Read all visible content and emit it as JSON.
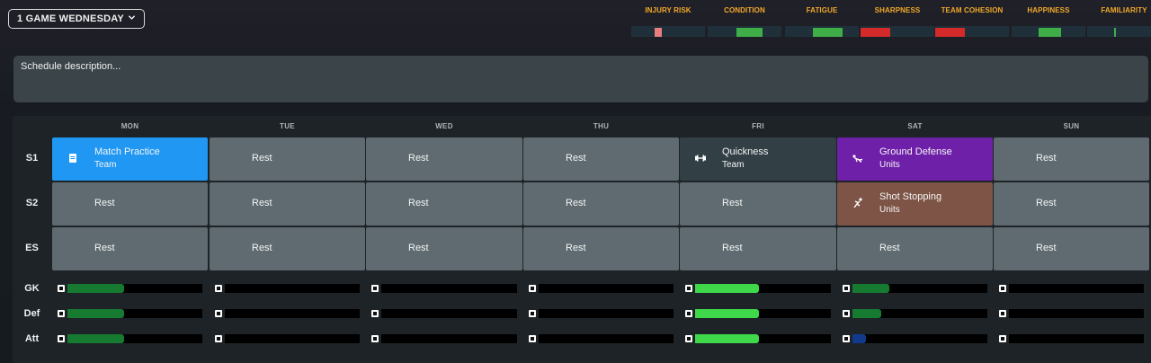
{
  "schedule_selector": {
    "label": "1 GAME WEDNESDAY"
  },
  "status": [
    {
      "label": "INJURY RISK",
      "level": 0.1,
      "color": "#e87e7e"
    },
    {
      "label": "CONDITION",
      "level": 0.35,
      "color": "#3fae49"
    },
    {
      "label": "FATIGUE",
      "level": 0.4,
      "color": "#3fae49"
    },
    {
      "label": "SHARPNESS",
      "level": 0.4,
      "color": "#d42a2a"
    },
    {
      "label": "TEAM COHESION",
      "level": 0.4,
      "color": "#d42a2a"
    },
    {
      "label": "HAPPINESS",
      "level": 0.3,
      "color": "#3fae49"
    },
    {
      "label": "FAMILIARITY",
      "level": 0.03,
      "color": "#3fae49"
    }
  ],
  "description": {
    "placeholder": "Schedule description..."
  },
  "days": [
    "MON",
    "TUE",
    "WED",
    "THU",
    "FRI",
    "SAT",
    "SUN"
  ],
  "sessions": [
    {
      "label": "S1",
      "cells": [
        {
          "title": "Match Practice",
          "subtitle": "Team",
          "color": "#1f97f3",
          "icon": "clipboard-icon"
        },
        {
          "title": "Rest"
        },
        {
          "title": "Rest"
        },
        {
          "title": "Rest"
        },
        {
          "title": "Quickness",
          "subtitle": "Team",
          "color": "#323f45",
          "icon": "dumbbell-icon"
        },
        {
          "title": "Ground Defense",
          "subtitle": "Units",
          "color": "#6f20a8",
          "icon": "slide-tackle-icon"
        },
        {
          "title": "Rest"
        }
      ]
    },
    {
      "label": "S2",
      "cells": [
        {
          "title": "Rest"
        },
        {
          "title": "Rest"
        },
        {
          "title": "Rest"
        },
        {
          "title": "Rest"
        },
        {
          "title": "Rest"
        },
        {
          "title": "Shot Stopping",
          "subtitle": "Units",
          "color": "#7e5446",
          "icon": "goalkeeper-dive-icon"
        },
        {
          "title": "Rest"
        }
      ]
    },
    {
      "label": "ES",
      "cells": [
        {
          "title": "Rest"
        },
        {
          "title": "Rest"
        },
        {
          "title": "Rest"
        },
        {
          "title": "Rest"
        },
        {
          "title": "Rest"
        },
        {
          "title": "Rest"
        },
        {
          "title": "Rest"
        }
      ]
    }
  ],
  "workload": [
    {
      "label": "GK",
      "bars": [
        {
          "level": 0.42,
          "color": "#167a30"
        },
        {
          "level": 0
        },
        {
          "level": 0
        },
        {
          "level": 0
        },
        {
          "level": 0.47,
          "color": "#3ed84a"
        },
        {
          "level": 0.27,
          "color": "#167a30"
        },
        {
          "level": 0
        }
      ]
    },
    {
      "label": "Def",
      "bars": [
        {
          "level": 0.42,
          "color": "#167a30"
        },
        {
          "level": 0
        },
        {
          "level": 0
        },
        {
          "level": 0
        },
        {
          "level": 0.47,
          "color": "#3ed84a"
        },
        {
          "level": 0.21,
          "color": "#167a30"
        },
        {
          "level": 0
        }
      ]
    },
    {
      "label": "Att",
      "bars": [
        {
          "level": 0.42,
          "color": "#167a30"
        },
        {
          "level": 0
        },
        {
          "level": 0
        },
        {
          "level": 0
        },
        {
          "level": 0.47,
          "color": "#3ed84a"
        },
        {
          "level": 0.1,
          "color": "#123a8c"
        },
        {
          "level": 0
        }
      ]
    }
  ]
}
